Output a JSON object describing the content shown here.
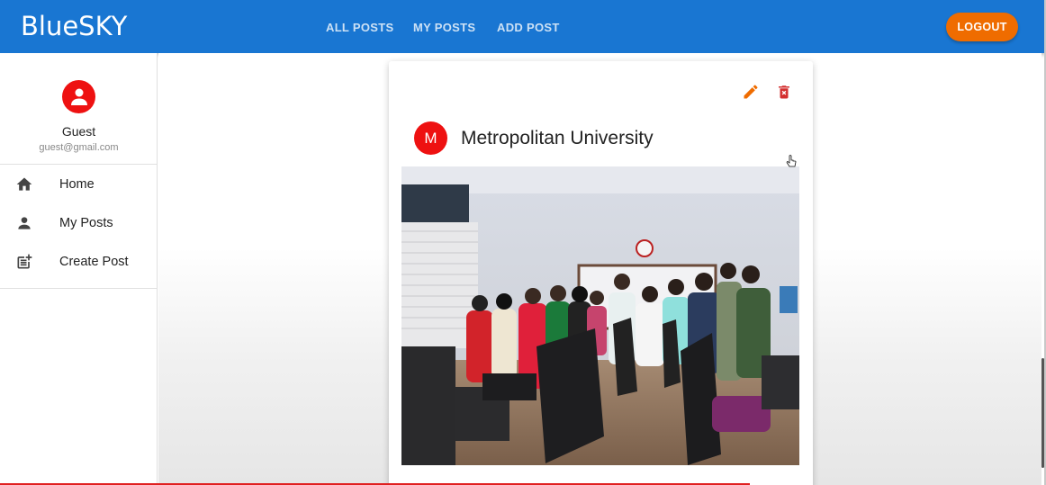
{
  "app": {
    "brand": "BlueSKY"
  },
  "nav": {
    "all_posts": "ALL POSTS",
    "my_posts": "MY POSTS",
    "add_post": "ADD POST",
    "logout": "LOGOUT"
  },
  "user": {
    "name": "Guest",
    "email": "guest@gmail.com"
  },
  "menu": [
    {
      "label": "Home",
      "icon": "home-icon"
    },
    {
      "label": "My Posts",
      "icon": "person-icon"
    },
    {
      "label": "Create Post",
      "icon": "post-add-icon"
    }
  ],
  "post": {
    "avatar_letter": "M",
    "title": "Metropolitan University",
    "image": "group-photo-computer-lab"
  },
  "colors": {
    "primary": "#1976d2",
    "accent": "#ef6c00",
    "avatar": "#ee1111",
    "edit": "#ef6c00",
    "delete": "#d32f2f"
  }
}
